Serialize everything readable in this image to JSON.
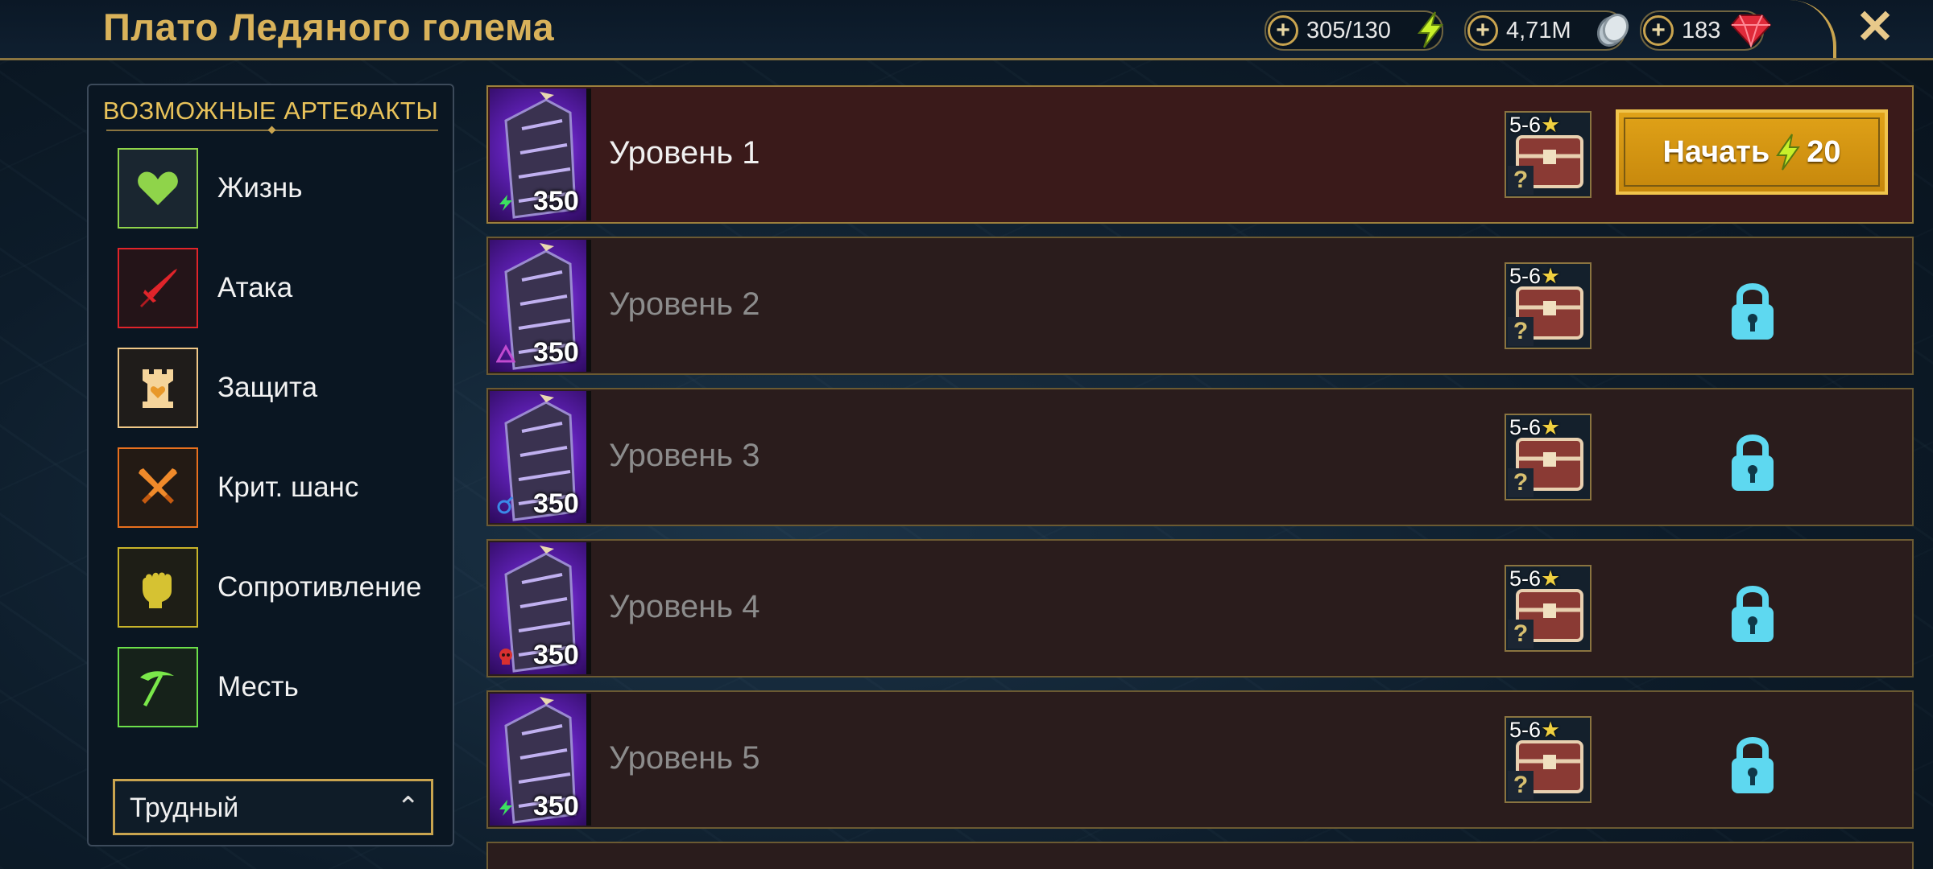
{
  "header": {
    "title": "Плато Ледяного голема",
    "resources": [
      {
        "value": "305/130",
        "icon": "energy-icon"
      },
      {
        "value": "4,71M",
        "icon": "silver-icon"
      },
      {
        "value": "183",
        "icon": "gem-icon"
      }
    ],
    "plus_label": "+",
    "close_label": "✕"
  },
  "left_panel": {
    "heading": "ВОЗМОЖНЫЕ АРТЕФАКТЫ",
    "sets": [
      {
        "label": "Жизнь",
        "icon": "heart-icon",
        "color": "#8fd44a"
      },
      {
        "label": "Атака",
        "icon": "sword-icon",
        "color": "#e0242a"
      },
      {
        "label": "Защита",
        "icon": "tower-icon",
        "color": "#f0c888"
      },
      {
        "label": "Крит. шанс",
        "icon": "crossed-swords-icon",
        "color": "#e8701e"
      },
      {
        "label": "Сопротивление",
        "icon": "fist-icon",
        "color": "#c8b42a"
      },
      {
        "label": "Месть",
        "icon": "scythe-icon",
        "color": "#6ce04a"
      }
    ],
    "difficulty": {
      "selected": "Трудный",
      "chevron": "⌃"
    }
  },
  "levels": [
    {
      "name": "Уровень 1",
      "power": "350",
      "affinity": "force",
      "reward_stars": "5-6",
      "reward_q": "?",
      "state": "available"
    },
    {
      "name": "Уровень 2",
      "power": "350",
      "affinity": "void",
      "reward_stars": "5-6",
      "reward_q": "?",
      "state": "locked"
    },
    {
      "name": "Уровень 3",
      "power": "350",
      "affinity": "magic",
      "reward_stars": "5-6",
      "reward_q": "?",
      "state": "locked"
    },
    {
      "name": "Уровень 4",
      "power": "350",
      "affinity": "spirit",
      "reward_stars": "5-6",
      "reward_q": "?",
      "state": "locked"
    },
    {
      "name": "Уровень 5",
      "power": "350",
      "affinity": "force",
      "reward_stars": "5-6",
      "reward_q": "?",
      "state": "locked"
    }
  ],
  "start_button": {
    "label": "Начать",
    "cost": "20"
  },
  "colors": {
    "gold": "#c9a44f",
    "title": "#d9b25a",
    "lock": "#5ed8f0"
  }
}
